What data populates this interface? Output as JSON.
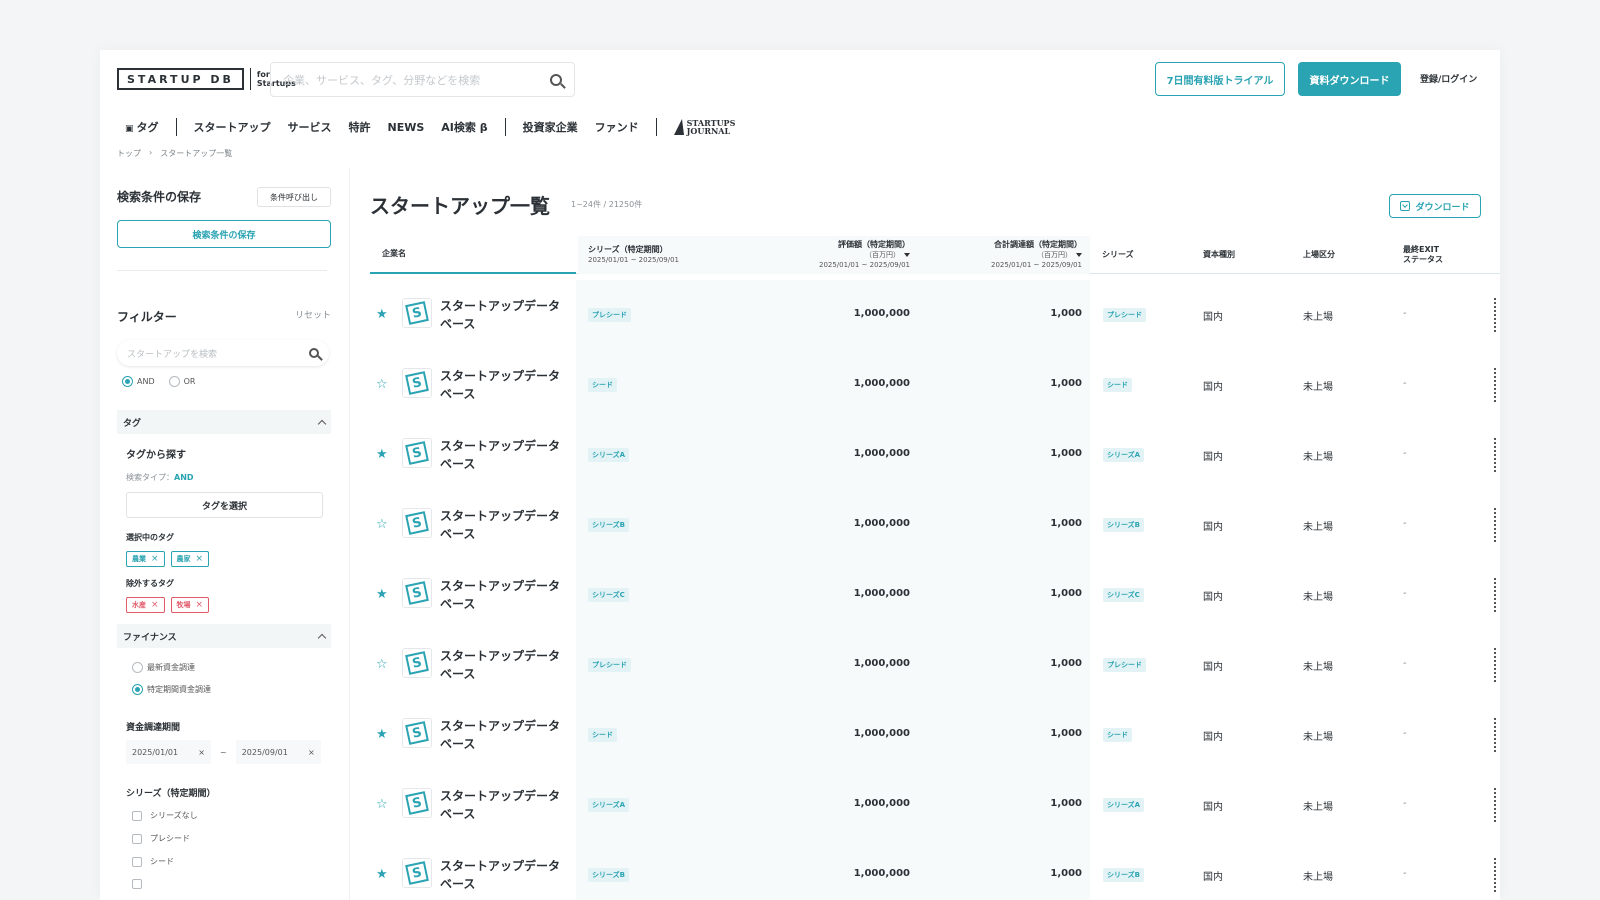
{
  "header": {
    "logo_main": "STARTUP DB",
    "logo_for_line1": "for",
    "logo_for_line2": "Startups",
    "search_placeholder": "企業、サービス、タグ、分野などを検索",
    "trial_button": "7日間有料版トライアル",
    "download_button": "資料ダウンロード",
    "login_link": "登録/ログイン"
  },
  "nav": {
    "tag": "タグ",
    "startup": "スタートアップ",
    "service": "サービス",
    "patent": "特許",
    "news": "NEWS",
    "ai_search": "AI検索 β",
    "investor": "投資家企業",
    "fund": "ファンド",
    "journal_line1": "STARTUPS",
    "journal_line2": "JOURNAL"
  },
  "breadcrumb": {
    "top": "トップ",
    "sep": "›",
    "current": "スタートアップ一覧"
  },
  "sidebar": {
    "save_title": "検索条件の保存",
    "load_button": "条件呼び出し",
    "save_button": "検索条件の保存",
    "filter_title": "フィルター",
    "reset": "リセット",
    "search_placeholder": "スタートアップを検索",
    "and_label": "AND",
    "or_label": "OR",
    "tag_section": "タグ",
    "tag_find": "タグから探す",
    "search_type_label": "検索タイプ：",
    "search_type_value": "AND",
    "select_tag_button": "タグを選択",
    "selected_tags_label": "選択中のタグ",
    "selected_tags": [
      "農業",
      "農家"
    ],
    "excluded_tags_label": "除外するタグ",
    "excluded_tags": [
      "水産",
      "牧場"
    ],
    "finance_section": "ファイナンス",
    "latest_funding": "最新資金調達",
    "period_funding": "特定期間資金調達",
    "funding_period_label": "資金調達期間",
    "date_from": "2025/01/01",
    "date_to": "2025/09/01",
    "date_tilde": "~",
    "series_label": "シリーズ（特定期間）",
    "series_options": [
      "シリーズなし",
      "プレシード",
      "シード"
    ]
  },
  "main": {
    "title": "スタートアップ一覧",
    "count": "1~24件 / 21250件",
    "download": "ダウンロード"
  },
  "table": {
    "headers": {
      "name": "企業名",
      "series_period": "シリーズ（特定期間）",
      "series_period_sub": "2025/01/01 ~ 2025/09/01",
      "valuation": "評価額（特定期間）",
      "valuation_unit": "（百万円）",
      "valuation_sub": "2025/01/01 ~ 2025/09/01",
      "total_funding": "合計調達額（特定期間）",
      "total_funding_unit": "（百万円）",
      "total_funding_sub": "2025/01/01 ~ 2025/09/01",
      "series": "シリーズ",
      "capital_type": "資本種別",
      "listing": "上場区分",
      "exit_line1": "最終EXIT",
      "exit_line2": "ステータス"
    },
    "rows": [
      {
        "starred": true,
        "name": "スタートアップデータベース",
        "series_period": "プレシード",
        "valuation": "1,000,000",
        "funding": "1,000",
        "series": "プレシード",
        "capital": "国内",
        "listing": "未上場",
        "exit": "-"
      },
      {
        "starred": false,
        "name": "スタートアップデータベース",
        "series_period": "シード",
        "valuation": "1,000,000",
        "funding": "1,000",
        "series": "シード",
        "capital": "国内",
        "listing": "未上場",
        "exit": "-"
      },
      {
        "starred": true,
        "name": "スタートアップデータベース",
        "series_period": "シリーズA",
        "valuation": "1,000,000",
        "funding": "1,000",
        "series": "シリーズA",
        "capital": "国内",
        "listing": "未上場",
        "exit": "-"
      },
      {
        "starred": false,
        "name": "スタートアップデータベース",
        "series_period": "シリーズB",
        "valuation": "1,000,000",
        "funding": "1,000",
        "series": "シリーズB",
        "capital": "国内",
        "listing": "未上場",
        "exit": "-"
      },
      {
        "starred": true,
        "name": "スタートアップデータベース",
        "series_period": "シリーズC",
        "valuation": "1,000,000",
        "funding": "1,000",
        "series": "シリーズC",
        "capital": "国内",
        "listing": "未上場",
        "exit": "-"
      },
      {
        "starred": false,
        "name": "スタートアップデータベース",
        "series_period": "プレシード",
        "valuation": "1,000,000",
        "funding": "1,000",
        "series": "プレシード",
        "capital": "国内",
        "listing": "未上場",
        "exit": "-"
      },
      {
        "starred": true,
        "name": "スタートアップデータベース",
        "series_period": "シード",
        "valuation": "1,000,000",
        "funding": "1,000",
        "series": "シード",
        "capital": "国内",
        "listing": "未上場",
        "exit": "-"
      },
      {
        "starred": false,
        "name": "スタートアップデータベース",
        "series_period": "シリーズA",
        "valuation": "1,000,000",
        "funding": "1,000",
        "series": "シリーズA",
        "capital": "国内",
        "listing": "未上場",
        "exit": "-"
      },
      {
        "starred": true,
        "name": "スタートアップデータベース",
        "series_period": "シリーズB",
        "valuation": "1,000,000",
        "funding": "1,000",
        "series": "シリーズB",
        "capital": "国内",
        "listing": "未上場",
        "exit": "-"
      }
    ]
  },
  "icons": {
    "logo_letter": "S",
    "star_filled": "★",
    "star_outline": "☆",
    "close": "×",
    "tag_icon": "▣"
  },
  "colors": {
    "accent": "#2aa3b2",
    "danger": "#e25a6a"
  }
}
